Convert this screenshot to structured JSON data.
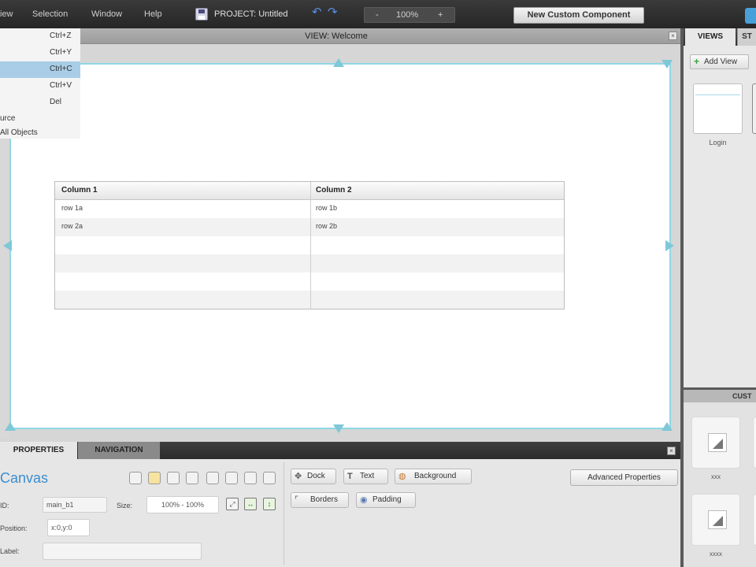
{
  "menubar": {
    "items": [
      "iew",
      "Selection",
      "Window",
      "Help"
    ],
    "project_title": "PROJECT: Untitled",
    "undo_glyph": "↶",
    "redo_glyph": "↷",
    "zoom_minus": "-",
    "zoom_value": "100%",
    "zoom_plus": "+",
    "new_component_label": "New Custom Component"
  },
  "edit_menu": {
    "items": [
      {
        "label": "",
        "shortcut": "Ctrl+Z"
      },
      {
        "label": "",
        "shortcut": "Ctrl+Y"
      },
      {
        "label": "",
        "shortcut": "Ctrl+C",
        "highlighted": true
      },
      {
        "label": "",
        "shortcut": "Ctrl+V"
      },
      {
        "label": "",
        "shortcut": "Del"
      },
      {
        "label": "urce",
        "shortcut": ""
      },
      {
        "label": "All Objects",
        "shortcut": ""
      }
    ]
  },
  "view": {
    "title": "VIEW: Welcome",
    "close_glyph": "×"
  },
  "grid": {
    "columns": [
      "Column 1",
      "Column 2"
    ],
    "rows": [
      [
        "row 1a",
        "row 1b"
      ],
      [
        "row 2a",
        "row 2b"
      ],
      [
        "",
        ""
      ],
      [
        "",
        ""
      ],
      [
        "",
        ""
      ],
      [
        "",
        ""
      ]
    ]
  },
  "views_panel": {
    "tabs": [
      "VIEWS",
      "ST"
    ],
    "add_view_label": "Add View",
    "thumbnails": [
      {
        "label": "Login"
      }
    ]
  },
  "custom_panel": {
    "tab": "CUST",
    "components": [
      {
        "label": "xxx"
      },
      {
        "label": "xxxx"
      }
    ]
  },
  "properties": {
    "tabs": [
      "PROPERTIES",
      "NAVIGATION"
    ],
    "close_glyph": "×",
    "title": "Canvas",
    "id_label": "ID:",
    "id_value": "main_b1",
    "size_label": "Size:",
    "size_value": "100% - 100%",
    "position_label": "Position:",
    "position_value": "x:0,y:0",
    "label_label": "Label:",
    "label_value": "",
    "buttons": {
      "dock": "Dock",
      "text": "Text",
      "background": "Background",
      "borders": "Borders",
      "padding": "Padding",
      "advanced": "Advanced Properties"
    }
  },
  "colors": {
    "accent": "#3c8ed0",
    "selection_handles": "#7ec8d8",
    "menu_highlight": "#a9cde6"
  }
}
